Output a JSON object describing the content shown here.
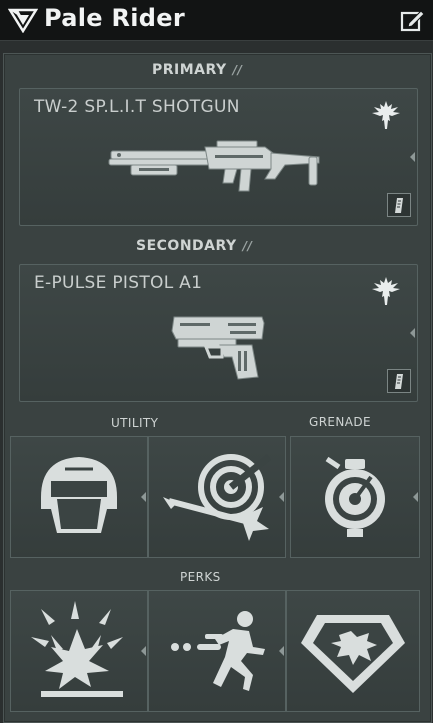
{
  "header": {
    "title": "Pale Rider"
  },
  "loadout": {
    "primary": {
      "label": "PRIMARY",
      "slashes": "//",
      "weapon_name": "TW-2 SP.L.I.T SHOTGUN"
    },
    "secondary": {
      "label": "SECONDARY",
      "slashes": "//",
      "weapon_name": "E-PULSE PISTOL A1"
    },
    "utility_label": "UTILITY",
    "grenade_label": "GRENADE",
    "perks_label": "PERKS"
  },
  "icons": {
    "logo": "faction-logo",
    "edit": "edit-icon",
    "faction": "eagle-faction-icon",
    "mod": "attachment-mod-icon",
    "utility_1": "helmet-icon",
    "utility_2": "target-dart-icon",
    "grenade": "grenade-icon",
    "perk_1": "impact-burst-icon",
    "perk_2": "sprint-icon",
    "perk_3": "creature-shield-icon"
  },
  "colors": {
    "background": "#2b2f2f",
    "titlebar": "#121414",
    "panel": "#3a4241",
    "card_border": "#566261",
    "icon_fill": "#d9dedd"
  }
}
